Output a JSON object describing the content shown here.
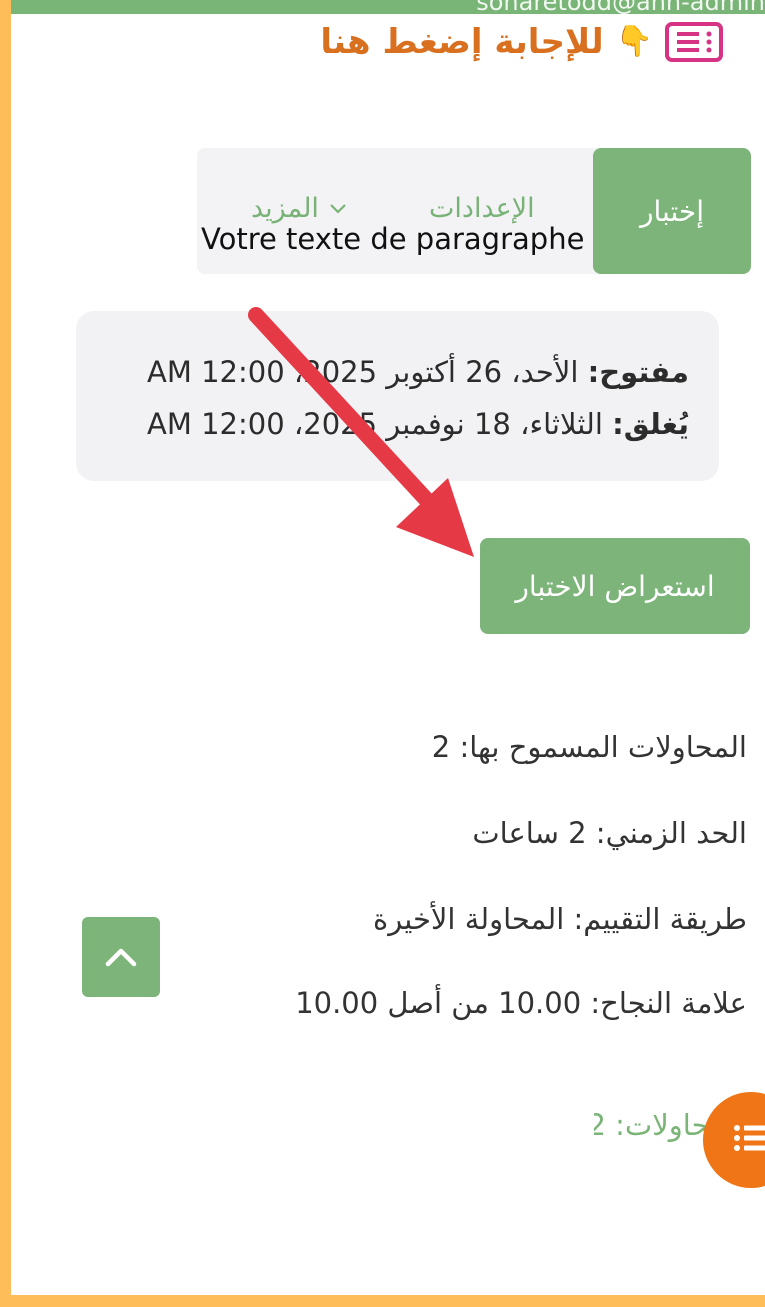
{
  "top_strip": {
    "text": "sonaretodd@ahh-admin"
  },
  "header": {
    "title": "للإجابة إضغط هنا",
    "hand_glyph": "👇",
    "list_icon": "checklist-icon",
    "title_color": "#d9701f"
  },
  "nav": {
    "active_label": "إختبار",
    "settings_label": "الإعدادات",
    "more_label": "المزيد",
    "accent": "#7db47a"
  },
  "overlay": {
    "paragraph_text": "Votre texte de paragraphe"
  },
  "dates": {
    "open_label": "مفتوح:",
    "open_value": " الأحد، 26 أكتوبر 2025، 12:00 AM",
    "close_label": "يُغلق:",
    "close_value": " الثلاثاء، 18 نوفمبر 2025، 12:00 AM"
  },
  "preview_button": {
    "label": "استعراض الاختبار"
  },
  "info": {
    "attempts_allowed": "المحاولات المسموح بها: 2",
    "time_limit": "الحد الزمني: 2 ساعات",
    "grading_method": "طريقة التقييم: المحاولة الأخيرة",
    "pass_grade": "علامة النجاح: 10.00 من أصل 10.00"
  },
  "attempts_summary": {
    "text": "المحاولات: 2"
  },
  "colors": {
    "frame": "#ffbd59",
    "arrow": "#e63946",
    "fab": "#f07516"
  }
}
